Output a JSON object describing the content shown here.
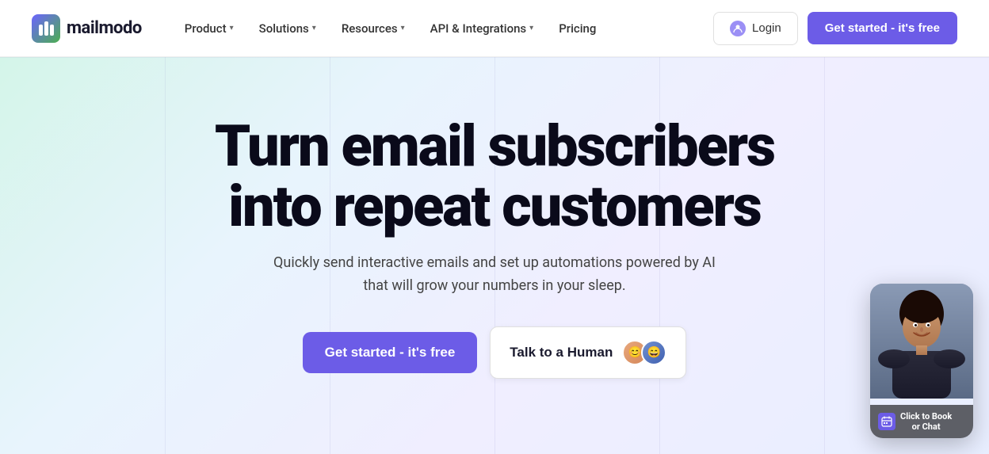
{
  "navbar": {
    "logo_text": "mailmodo",
    "nav_items": [
      {
        "label": "Product",
        "has_dropdown": true
      },
      {
        "label": "Solutions",
        "has_dropdown": true
      },
      {
        "label": "Resources",
        "has_dropdown": true
      },
      {
        "label": "API & Integrations",
        "has_dropdown": true
      },
      {
        "label": "Pricing",
        "has_dropdown": false
      }
    ],
    "login_label": "Login",
    "get_started_label": "Get started - it's free"
  },
  "hero": {
    "title_line1": "Turn email subscribers",
    "title_line2": "into repeat customers",
    "subtitle": "Quickly send interactive emails and set up automations powered by AI that will grow your numbers in your sleep.",
    "cta_primary_bold": "Get started",
    "cta_primary_suffix": " - it's free",
    "cta_secondary": "Talk to a Human"
  },
  "chat_widget": {
    "label_line1": "Click to Book",
    "label_line2": "or Chat"
  },
  "colors": {
    "accent": "#6c5ce7",
    "text_dark": "#0a0a1a",
    "text_muted": "#444"
  }
}
